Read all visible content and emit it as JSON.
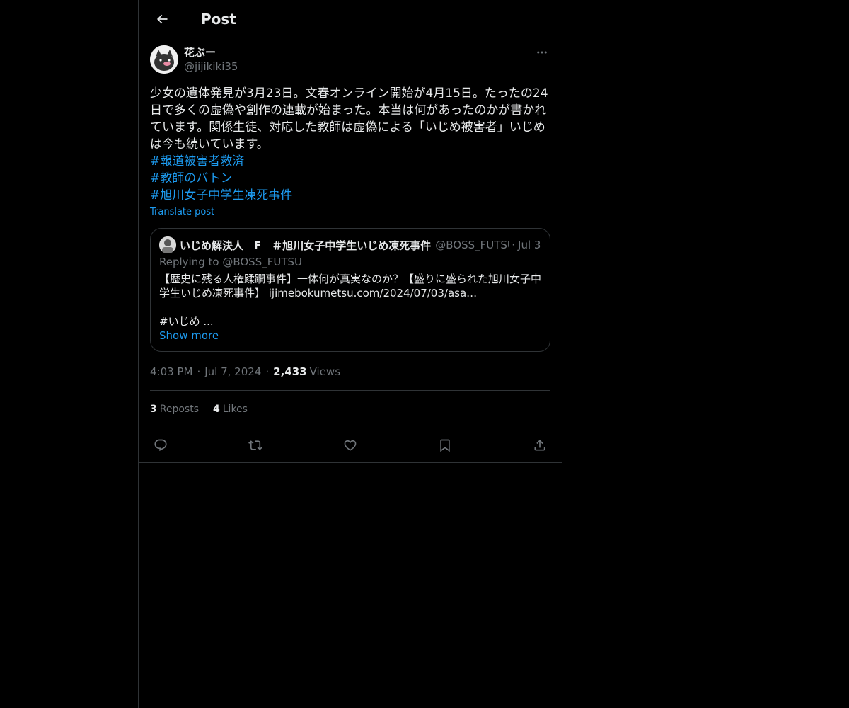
{
  "header": {
    "title": "Post"
  },
  "post": {
    "author": {
      "display_name": "花ぶー",
      "handle": "@jijikiki35"
    },
    "text": "少女の遺体発見が3月23日。文春オンライン開始が4月15日。たったの24日で多くの虚偽や創作の連載が始まった。本当は何があったのかが書かれています。関係生徒、対応した教師は虚偽による「いじめ被害者」いじめは今も続いています。",
    "hashtags": [
      "#報道被害者救済",
      "#教師のバトン",
      "#旭川女子中学生凍死事件"
    ],
    "translate_label": "Translate post",
    "quote": {
      "name": "いじめ解決人　F　＃旭川女子中学生いじめ凍死事件",
      "handle": "@BOSS_FUTSU",
      "dot": "·",
      "date": "Jul 3",
      "replying": "Replying to @BOSS_FUTSU",
      "text": "【歴史に残る人権蹂躙事件】一体何が真実なのか？【盛りに盛られた旭川女子中学生いじめ凍死事件】 ijimebokumetsu.com/2024/07/03/asa…",
      "tag_line": "#いじめ ...",
      "show_more": "Show more"
    },
    "time": "4:03 PM",
    "date": "Jul 7, 2024",
    "separator": "·",
    "views_count": "2,433",
    "views_label": "Views",
    "reposts_count": "3",
    "reposts_label": "Reposts",
    "likes_count": "4",
    "likes_label": "Likes"
  },
  "actions": [
    "reply-icon",
    "repost-icon",
    "like-icon",
    "bookmark-icon",
    "share-icon"
  ],
  "colors": {
    "background": "#000000",
    "text": "#e7e9ea",
    "muted": "#71767b",
    "accent": "#1d9bf0",
    "border": "#2f3336"
  }
}
